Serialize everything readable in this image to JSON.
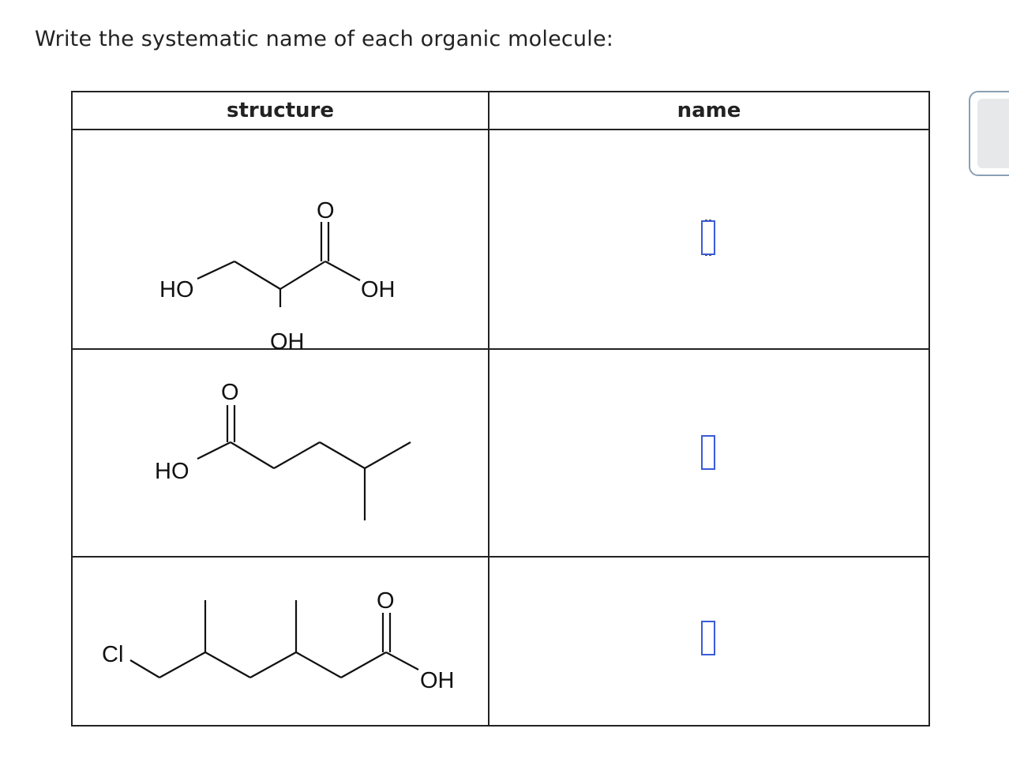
{
  "prompt": "Write the systematic name of each organic molecule:",
  "table": {
    "headers": [
      "structure",
      "name"
    ],
    "rows": [
      {
        "labels": {
          "ho": "HO",
          "oh_mid": "OH",
          "oh_right": "OH",
          "o_top": "O"
        },
        "answer": ""
      },
      {
        "labels": {
          "ho": "HO",
          "o_top": "O"
        },
        "answer": ""
      },
      {
        "labels": {
          "cl": "Cl",
          "o_top": "O",
          "oh": "OH"
        },
        "answer": ""
      }
    ]
  },
  "colors": {
    "answer_border": "#3a5bd9",
    "grid": "#222222"
  }
}
